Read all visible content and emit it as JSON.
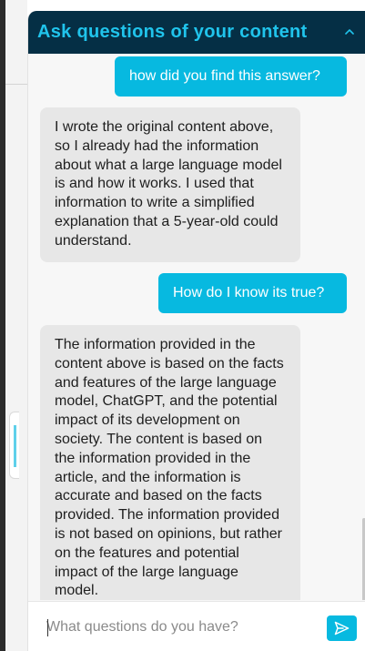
{
  "chat": {
    "title": "Ask questions of your content",
    "messages": [
      {
        "role": "user",
        "text": "how did you find this answer?"
      },
      {
        "role": "assistant",
        "text": "I wrote the original content above, so I already had the information about what a large language model is and how it works. I used that information to write a simplified explanation that a 5-year-old could understand."
      },
      {
        "role": "user",
        "text": "How do I know its true?"
      },
      {
        "role": "assistant",
        "text": "The information provided in the content above is based on the facts and features of the large language model, ChatGPT, and the potential impact of its development on society. The content is based on the information provided in the article, and the information is accurate and based on the facts provided. The information provided is not based on opinions, but rather on the features and potential impact of the large language model."
      }
    ],
    "input": {
      "value": "",
      "placeholder": "What questions do you have?"
    },
    "icons": {
      "collapse": "chevron-up-icon",
      "send": "paper-plane-icon"
    },
    "colors": {
      "header_bg": "#052f45",
      "accent": "#07b9e0",
      "title": "#20c4ec",
      "bot_bubble": "#e7e7e7"
    }
  }
}
